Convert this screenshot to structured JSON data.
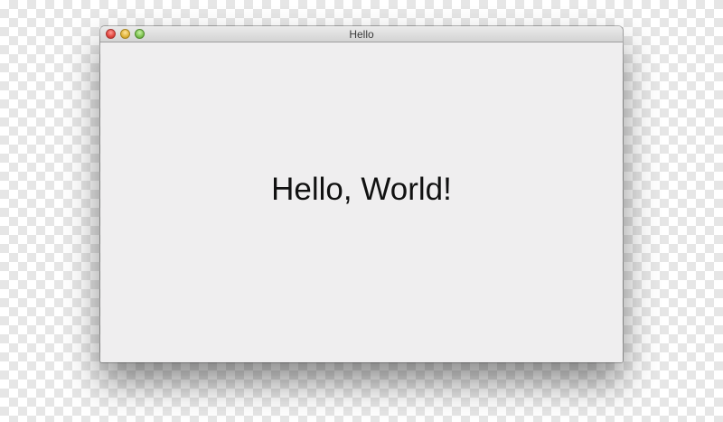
{
  "window": {
    "title": "Hello",
    "controls": {
      "close_icon": "close-traffic-light",
      "minimize_icon": "minimize-traffic-light",
      "zoom_icon": "zoom-traffic-light"
    }
  },
  "content": {
    "message": "Hello, World!"
  },
  "colors": {
    "close": "#e0443e",
    "minimize": "#e0b43a",
    "zoom": "#7ec251",
    "content_background": "#efeeef"
  }
}
